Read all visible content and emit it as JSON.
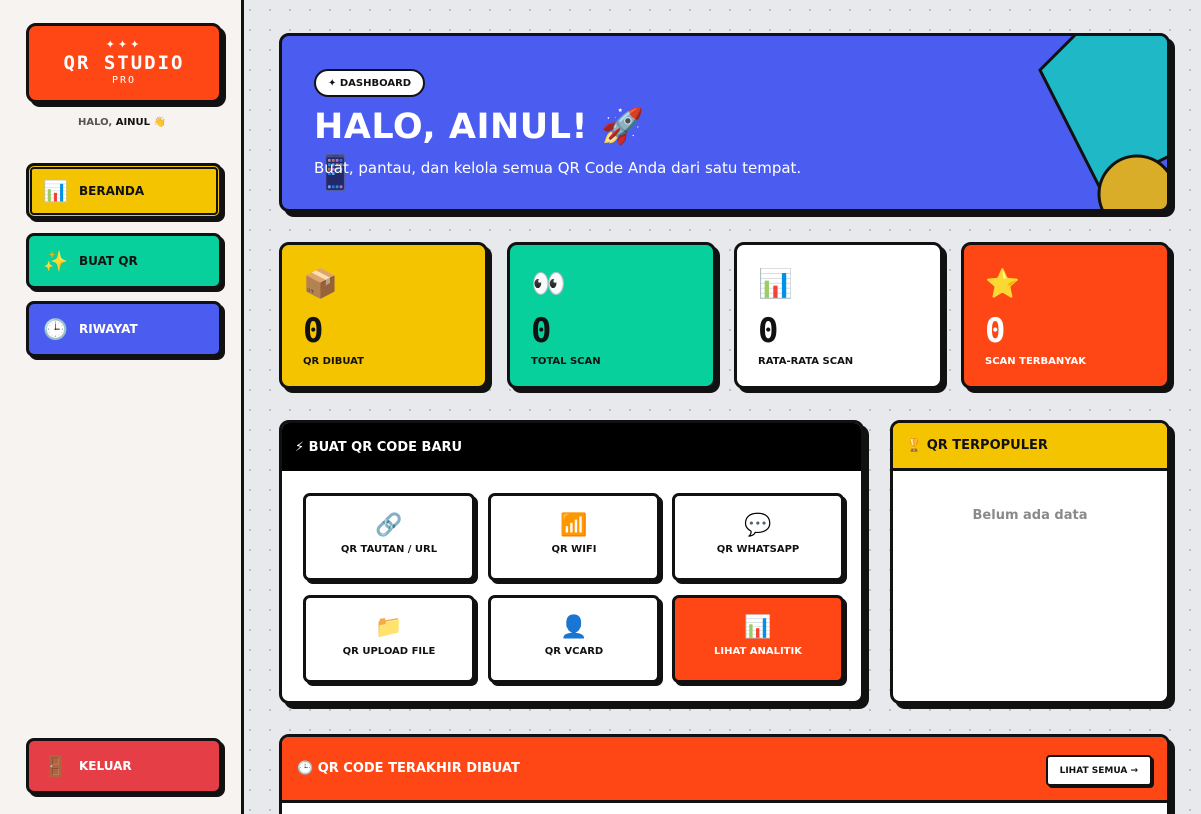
{
  "sidebar": {
    "logo_stars": "✦✦✦",
    "logo_title": "QR STUDIO",
    "logo_sub": "PRO",
    "greeting_prefix": "HALO, ",
    "greeting_name": "AINUL",
    "greeting_emoji": "👋",
    "items": [
      {
        "icon": "📊",
        "icon_name": "chart-icon",
        "label": "BERANDA"
      },
      {
        "icon": "✨",
        "icon_name": "sparkles-icon",
        "label": "BUAT QR"
      },
      {
        "icon": "🕒",
        "icon_name": "clock-icon",
        "label": "RIWAYAT"
      }
    ],
    "logout": {
      "icon": "🚪",
      "icon_name": "door-icon",
      "label": "KELUAR"
    }
  },
  "hero": {
    "badge": "✦ DASHBOARD",
    "title": "HALO, AINUL! 🚀",
    "phone_icon": "📱",
    "subtitle": "Buat, pantau, dan kelola semua QR Code Anda dari satu tempat."
  },
  "stats": [
    {
      "icon": "📦",
      "value": "0",
      "label": "QR DIBUAT"
    },
    {
      "icon": "👀",
      "value": "0",
      "label": "TOTAL SCAN"
    },
    {
      "icon": "📊",
      "value": "0",
      "label": "RATA-RATA SCAN"
    },
    {
      "icon": "⭐",
      "value": "0",
      "label": "SCAN TERBANYAK"
    }
  ],
  "create": {
    "title": "⚡ BUAT QR CODE BARU",
    "options": [
      {
        "icon": "🔗",
        "label": "QR TAUTAN / URL"
      },
      {
        "icon": "📶",
        "label": "QR WIFI"
      },
      {
        "icon": "💬",
        "label": "QR WHATSAPP"
      },
      {
        "icon": "📁",
        "label": "QR UPLOAD FILE"
      },
      {
        "icon": "👤",
        "label": "QR VCARD"
      },
      {
        "icon": "📊",
        "label": "LIHAT ANALITIK"
      }
    ]
  },
  "popular": {
    "title": "🏆 QR TERPOPULER",
    "empty": "Belum ada data"
  },
  "recent": {
    "title": "🕒 QR CODE TERAKHIR DIBUAT",
    "view_all": "LIHAT SEMUA →"
  },
  "colors": {
    "yellow": "#f5c400",
    "green": "#07d09c",
    "blue": "#4b5cf0",
    "orange": "#ff4615",
    "red": "#e53e46"
  }
}
